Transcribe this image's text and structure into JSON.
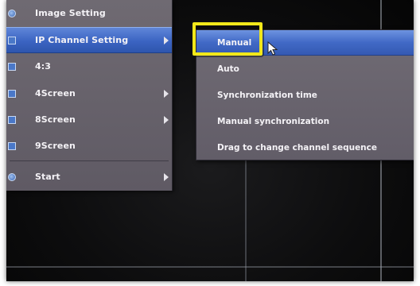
{
  "menu": {
    "items": [
      {
        "label": "Image Setting",
        "icon": "settings-icon",
        "has_submenu": false
      },
      {
        "label": "IP Channel Setting",
        "icon": "ip-channel-icon",
        "has_submenu": true,
        "selected": true
      },
      {
        "label": "4:3",
        "icon": "aspect-ratio-icon",
        "has_submenu": false
      },
      {
        "label": "4Screen",
        "icon": "four-screen-icon",
        "has_submenu": true
      },
      {
        "label": "8Screen",
        "icon": "eight-screen-icon",
        "has_submenu": true
      },
      {
        "label": "9Screen",
        "icon": "nine-screen-icon",
        "has_submenu": false
      },
      {
        "label": "Start",
        "icon": "start-icon",
        "has_submenu": true
      }
    ]
  },
  "submenu": {
    "items": [
      {
        "label": "Manual",
        "selected": true
      },
      {
        "label": "Auto"
      },
      {
        "label": "Synchronization time"
      },
      {
        "label": "Manual synchronization"
      },
      {
        "label": "Drag to change channel sequence"
      }
    ]
  },
  "colors": {
    "menu_bg": "#67626b",
    "selection_blue": "#3b64c2",
    "highlight_yellow": "#f2e81a"
  }
}
